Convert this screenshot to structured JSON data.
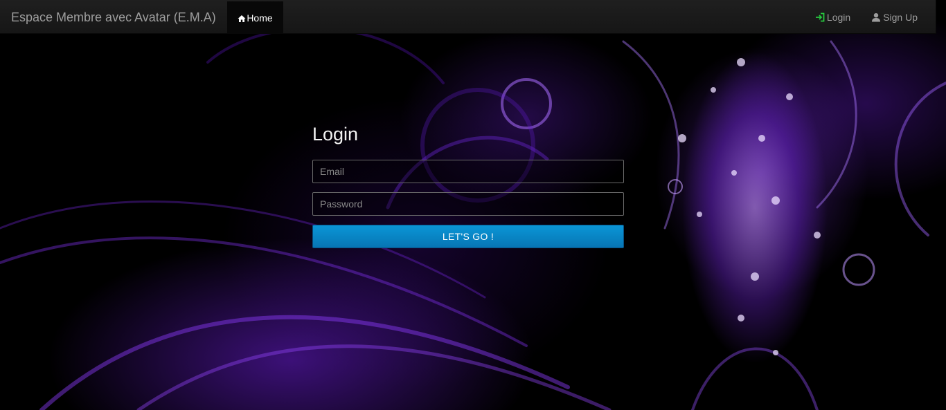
{
  "navbar": {
    "brand": "Espace Membre avec Avatar (E.M.A)",
    "home_label": "Home",
    "login_label": "Login",
    "signup_label": "Sign Up",
    "colors": {
      "login_icon": "#27c93f",
      "active_bg": "#080808"
    }
  },
  "icons": {
    "home": "home-icon",
    "login": "log-in-icon",
    "signup": "user-icon"
  },
  "login_form": {
    "title": "Login",
    "email_placeholder": "Email",
    "password_placeholder": "Password",
    "submit_label": "LET'S GO !",
    "colors": {
      "submit_bg": "#0a8ac8"
    }
  }
}
